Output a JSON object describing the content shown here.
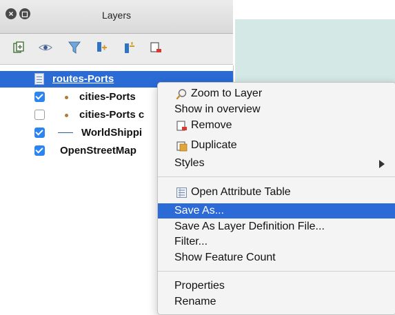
{
  "window": {
    "title": "Layers"
  },
  "toolbar": {
    "icons": [
      "add-group-icon",
      "eye-icon",
      "filter-icon",
      "expand-all-icon",
      "collapse-all-icon",
      "remove-layer-icon"
    ]
  },
  "layers": [
    {
      "label": "routes-Ports",
      "checked": null,
      "selected": true,
      "symbol": "table"
    },
    {
      "label": "cities-Ports",
      "checked": true,
      "symbol": "point"
    },
    {
      "label": "cities-Ports c",
      "checked": false,
      "symbol": "point"
    },
    {
      "label": "WorldShippi",
      "checked": true,
      "symbol": "line"
    },
    {
      "label": "OpenStreetMap",
      "checked": true,
      "symbol": "raster"
    }
  ],
  "context_menu": {
    "zoom_to_layer": "Zoom to Layer",
    "show_in_overview": "Show in overview",
    "remove": "Remove",
    "duplicate": "Duplicate",
    "styles": "Styles",
    "open_attribute_table": "Open Attribute Table",
    "save_as": "Save As...",
    "save_as_layer_def": "Save As Layer Definition File...",
    "filter": "Filter...",
    "show_feature_count": "Show Feature Count",
    "properties": "Properties",
    "rename": "Rename",
    "highlighted": "save_as"
  },
  "colors": {
    "selection": "#2c6ad7",
    "checkbox": "#2c84f2",
    "map_background": "#d4e8e6"
  }
}
